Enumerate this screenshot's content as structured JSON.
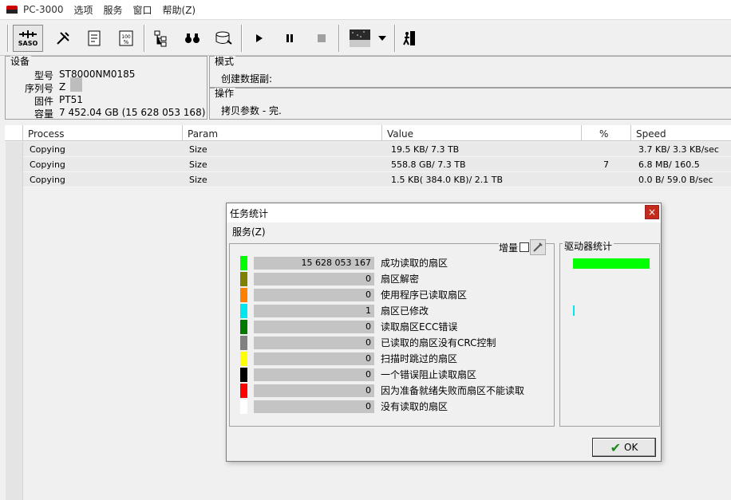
{
  "titlebar": {
    "app_title": "PC-3000",
    "menu": [
      "选项",
      "服务",
      "窗口",
      "帮助(Z)"
    ]
  },
  "toolbar": {
    "saso_label": "SASO",
    "buttons": [
      "tools-icon",
      "scroll-icon",
      "percent-scroll-icon",
      "tree-icon",
      "binoculars-icon",
      "disk-icon",
      "play-icon",
      "pause-icon",
      "stop-icon",
      "map-thumbnail-icon",
      "dropdown-icon",
      "exit-icon"
    ]
  },
  "device": {
    "title": "设备",
    "model_label": "型号",
    "model_value": "ST8000NM0185",
    "serial_label": "序列号",
    "serial_value": "Z",
    "firmware_label": "固件",
    "firmware_value": "PT51",
    "capacity_label": "容量",
    "capacity_value": "7 452.04 GB (15 628 053 168)"
  },
  "mode": {
    "title": "模式",
    "text": "创建数据副:"
  },
  "operation": {
    "title": "操作",
    "text": "拷贝参数 - 完."
  },
  "table": {
    "headers": [
      "Process",
      "Param",
      "Value",
      "%",
      "Speed"
    ],
    "rows": [
      {
        "process": "Copying",
        "param": "Size",
        "value": "19.5 KB/ 7.3 TB",
        "percent": "",
        "speed": "3.7 KB/ 3.3 KB/sec"
      },
      {
        "process": "Copying",
        "param": "Size",
        "value": "558.8 GB/ 7.3 TB",
        "percent": "7",
        "speed": "6.8 MB/ 160.5 MB/sec"
      },
      {
        "process": "Copying",
        "param": "Size",
        "value": "1.5 KB( 384.0 KB)/ 2.1 TB",
        "percent": "",
        "speed": "0.0 B/ 59.0 B/sec"
      }
    ]
  },
  "dialog": {
    "title": "任务统计",
    "close": "×",
    "menu": "服务(Z)",
    "increment_label": "增量",
    "drive_stats_title": "驱动器统计",
    "ok_label": "OK",
    "stats": [
      {
        "color": "#00ff00",
        "value": "15 628 053 167",
        "label": "成功读取的扇区"
      },
      {
        "color": "#7f7f00",
        "value": "0",
        "label": "扇区解密"
      },
      {
        "color": "#ff8000",
        "value": "0",
        "label": "使用程序已读取扇区"
      },
      {
        "color": "#00e5ee",
        "value": "1",
        "label": "扇区已修改"
      },
      {
        "color": "#007a00",
        "value": "0",
        "label": "读取扇区ECC错误"
      },
      {
        "color": "#808080",
        "value": "0",
        "label": "已读取的扇区没有CRC控制"
      },
      {
        "color": "#ffff00",
        "value": "0",
        "label": "扫描时跳过的扇区"
      },
      {
        "color": "#000000",
        "value": "0",
        "label": "一个错误阻止读取扇区"
      },
      {
        "color": "#ff0000",
        "value": "0",
        "label": "因为准备就绪失败而扇区不能读取"
      },
      {
        "color": "#ffffff",
        "value": "0",
        "label": "没有读取的扇区"
      }
    ]
  }
}
